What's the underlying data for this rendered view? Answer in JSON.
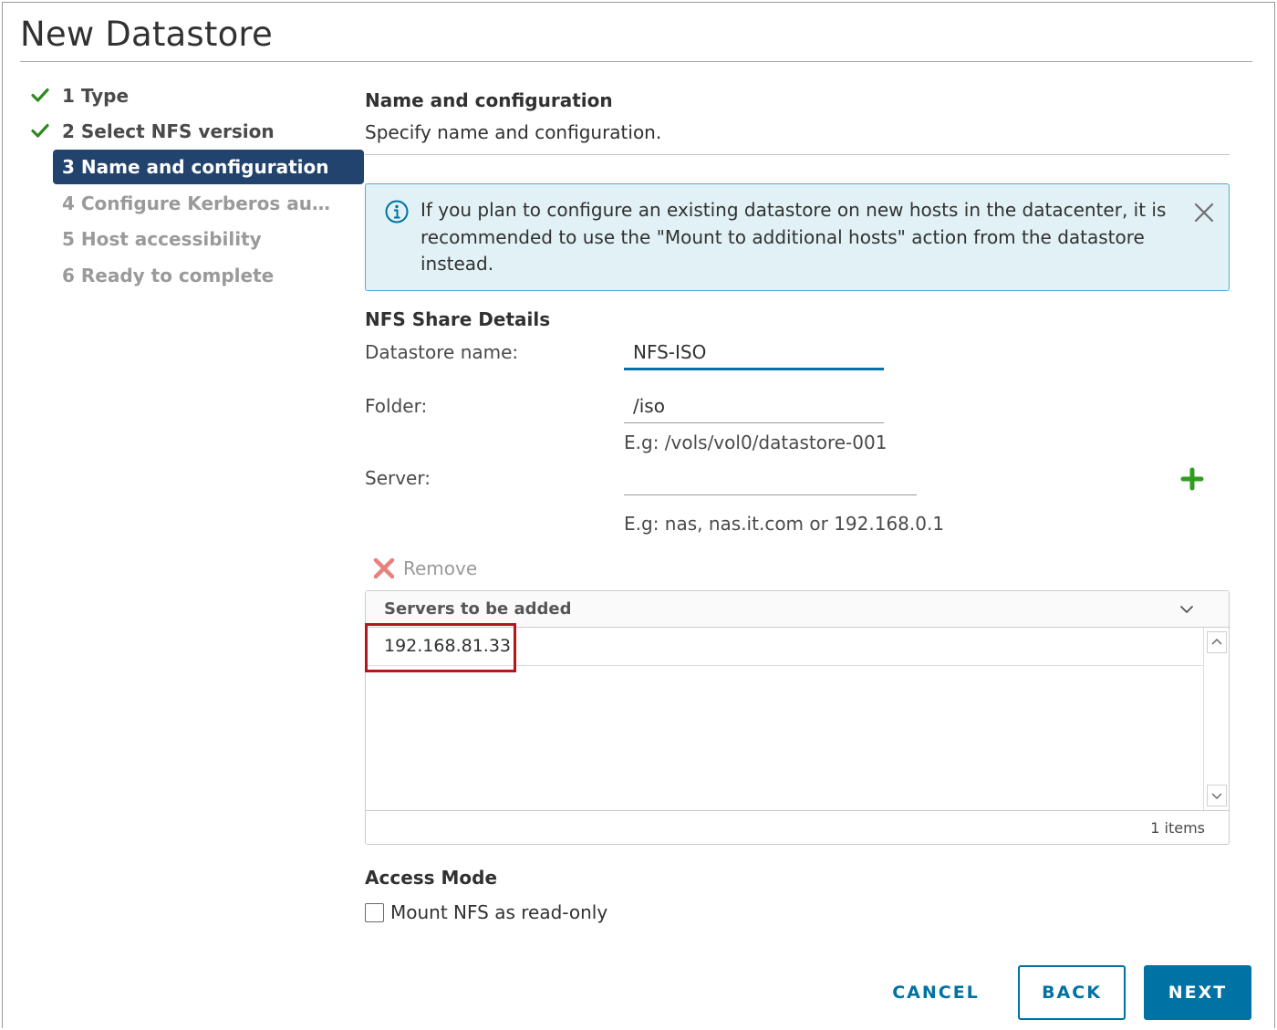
{
  "dialog": {
    "title": "New Datastore"
  },
  "steps": [
    {
      "label": "1 Type",
      "state": "done"
    },
    {
      "label": "2 Select NFS version",
      "state": "done"
    },
    {
      "label": "3 Name and configuration",
      "state": "active"
    },
    {
      "label": "4 Configure Kerberos auth...",
      "state": "pending"
    },
    {
      "label": "5 Host accessibility",
      "state": "pending"
    },
    {
      "label": "6 Ready to complete",
      "state": "pending"
    }
  ],
  "main": {
    "heading": "Name and configuration",
    "subheading": "Specify name and configuration.",
    "alert": {
      "text": "If you plan to configure an existing datastore on new hosts in the datacenter, it is recommended to use the \"Mount to additional hosts\" action from the datastore instead.",
      "icon": "info-icon"
    },
    "nfs_details": {
      "heading": "NFS Share Details",
      "datastore_name_label": "Datastore name:",
      "datastore_name_value": "NFS-ISO",
      "folder_label": "Folder:",
      "folder_value": "/iso",
      "folder_hint": "E.g: /vols/vol0/datastore-001",
      "server_label": "Server:",
      "server_value": "",
      "server_hint": "E.g: nas, nas.it.com or 192.168.0.1"
    },
    "remove_label": "Remove",
    "servers_grid": {
      "column": "Servers to be added",
      "rows": [
        "192.168.81.33"
      ],
      "footer_count": "1 items"
    },
    "access_mode": {
      "heading": "Access Mode",
      "checkbox_label": "Mount NFS as read-only",
      "checked": false
    }
  },
  "footer": {
    "cancel_label": "CANCEL",
    "back_label": "BACK",
    "next_label": "NEXT"
  },
  "colors": {
    "accent": "#0072a3",
    "active_step": "#22436e",
    "check": "#2e8b21",
    "alert_bg": "#e1f1f6",
    "alert_border": "#49afd9",
    "highlight": "#b5161d",
    "remove_icon": "#e8817c",
    "add_icon": "#2f9e1e"
  }
}
